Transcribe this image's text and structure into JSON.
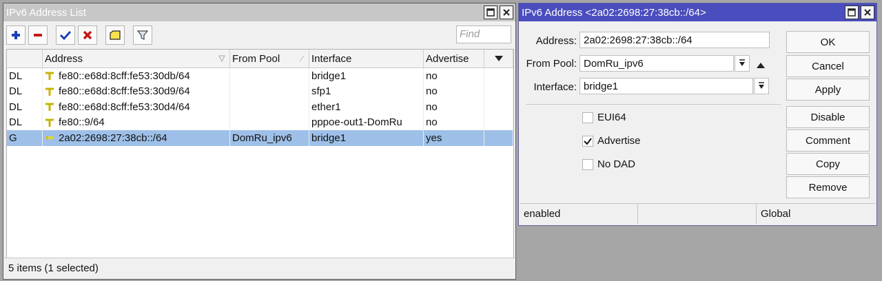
{
  "list_window": {
    "title": "IPv6 Address List",
    "find_placeholder": "Find",
    "columns": [
      "Address",
      "From Pool",
      "Interface",
      "Advertise"
    ],
    "rows": [
      {
        "flags": "DL",
        "address": "fe80::e68d:8cff:fe53:30db/64",
        "pool": "",
        "interface": "bridge1",
        "advertise": "no"
      },
      {
        "flags": "DL",
        "address": "fe80::e68d:8cff:fe53:30d9/64",
        "pool": "",
        "interface": "sfp1",
        "advertise": "no"
      },
      {
        "flags": "DL",
        "address": "fe80::e68d:8cff:fe53:30d4/64",
        "pool": "",
        "interface": "ether1",
        "advertise": "no"
      },
      {
        "flags": "DL",
        "address": "fe80::9/64",
        "pool": "",
        "interface": "pppoe-out1-DomRu",
        "advertise": "no"
      },
      {
        "flags": "G",
        "address": "2a02:2698:27:38cb::/64",
        "pool": "DomRu_ipv6",
        "interface": "bridge1",
        "advertise": "yes"
      }
    ],
    "status": "5 items (1 selected)"
  },
  "edit_window": {
    "title": "IPv6 Address <2a02:2698:27:38cb::/64>",
    "address_label": "Address:",
    "address_value": "2a02:2698:27:38cb::/64",
    "pool_label": "From Pool:",
    "pool_value": "DomRu_ipv6",
    "interface_label": "Interface:",
    "interface_value": "bridge1",
    "checkboxes": [
      {
        "label": "EUI64",
        "checked": false
      },
      {
        "label": "Advertise",
        "checked": true
      },
      {
        "label": "No DAD",
        "checked": false
      }
    ],
    "buttons": [
      "OK",
      "Cancel",
      "Apply",
      "Disable",
      "Comment",
      "Copy",
      "Remove"
    ],
    "status": [
      "enabled",
      "",
      "Global"
    ]
  },
  "colors": {
    "active_title": "#4a4dbd",
    "selected_row": "#9ec0e8"
  }
}
